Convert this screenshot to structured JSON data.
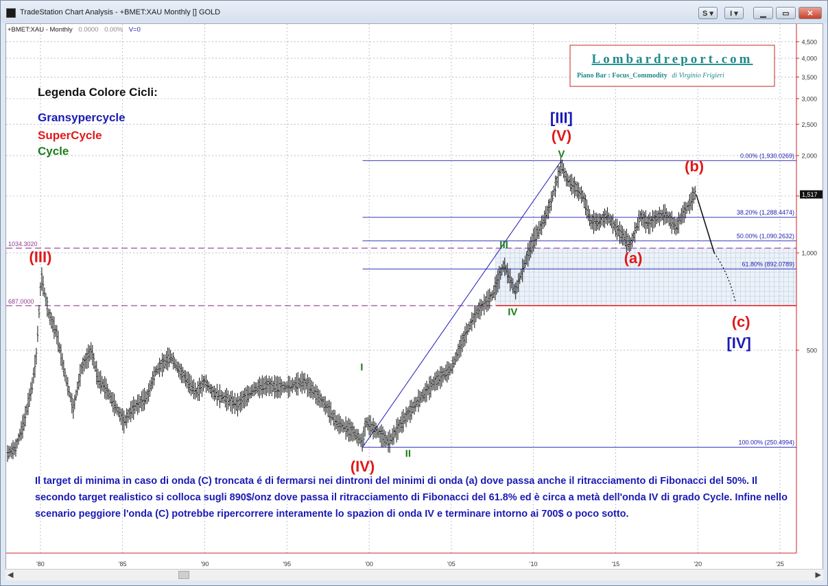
{
  "window": {
    "title": "TradeStation Chart Analysis - +BMET:XAU Monthly [] GOLD",
    "buttons": {
      "s": "S",
      "i": "I"
    }
  },
  "chart_header": {
    "symbol": "+BMET:XAU - Monthly",
    "value1": "0.0000",
    "value2": "0.00%",
    "volume": "V=0"
  },
  "brand": {
    "name": "Lombardreport.com",
    "subtitle_bold": "Piano Bar : Focus_Commodity",
    "subtitle_author": "di Virginio Frigieri"
  },
  "legend": {
    "title": "Legenda Colore Cicli:",
    "items": [
      {
        "label": "Gransypercycle",
        "color": "#1a1ab4"
      },
      {
        "label": "SuperCycle",
        "color": "#e01818"
      },
      {
        "label": "Cycle",
        "color": "#1c7d1c"
      }
    ]
  },
  "chart_data": {
    "type": "line",
    "scale": "log",
    "ylim": [
      200,
      5000
    ],
    "xlim": [
      1978.0,
      2026.0
    ],
    "x_ticks": [
      "'80",
      "'85",
      "'90",
      "'95",
      "'00",
      "'05",
      "'10",
      "'15",
      "'20",
      "'25"
    ],
    "x_tick_years": [
      1980,
      1985,
      1990,
      1995,
      2000,
      2005,
      2010,
      2015,
      2020,
      2025
    ],
    "y_ticks": [
      500,
      1000,
      1500,
      2000,
      2500,
      3000,
      3500,
      4000,
      4500
    ],
    "y_tick_labels": [
      "500",
      "1,000",
      "1,500",
      "2,000",
      "2,500",
      "3,000",
      "3,500",
      "4,000",
      "4,500"
    ],
    "last_price_label": "1,517",
    "series": [
      {
        "x": [
          1978.0,
          1978.5,
          1979.0,
          1979.5,
          1979.75,
          1980.05,
          1980.5,
          1981.0,
          1981.5,
          1982.0,
          1982.5,
          1983.1,
          1983.5,
          1984.0,
          1984.5,
          1985.1,
          1985.6,
          1986.5,
          1987.0,
          1987.9,
          1988.5,
          1989.0,
          1989.5,
          1990.0,
          1990.5,
          1991.0,
          1992.0,
          1993.0,
          1993.7,
          1994.5,
          1995.0,
          1996.0,
          1996.5,
          1997.5,
          1998.0,
          1999.0,
          1999.6,
          1999.8,
          2000.5,
          2001.2,
          2002.0,
          2003.0,
          2004.0,
          2005.0,
          2006.0,
          2006.5,
          2007.5,
          2008.2,
          2008.9,
          2009.5,
          2010.0,
          2010.5,
          2011.0,
          2011.7,
          2012.0,
          2012.5,
          2013.0,
          2013.5,
          2014.0,
          2014.5,
          2015.0,
          2015.9,
          2016.5,
          2017.0,
          2017.5,
          2018.0,
          2018.7,
          2019.0,
          2019.5,
          2019.9
        ],
        "values": [
          240,
          250,
          300,
          390,
          480,
          850,
          650,
          560,
          420,
          330,
          440,
          500,
          410,
          380,
          340,
          300,
          330,
          360,
          430,
          480,
          430,
          400,
          370,
          400,
          370,
          360,
          340,
          380,
          390,
          385,
          385,
          400,
          380,
          330,
          300,
          280,
          260,
          300,
          280,
          260,
          300,
          350,
          400,
          440,
          580,
          650,
          740,
          920,
          760,
          940,
          1100,
          1220,
          1400,
          1880,
          1700,
          1600,
          1500,
          1250,
          1250,
          1300,
          1200,
          1060,
          1300,
          1230,
          1290,
          1320,
          1200,
          1300,
          1420,
          1560
        ]
      }
    ],
    "projection": {
      "x": [
        2019.9,
        2021.0,
        2022.3
      ],
      "values": [
        1517,
        1000,
        700
      ]
    },
    "fibonacci": [
      {
        "label": "0.00% (1,930.0269)",
        "value": 1930.0269
      },
      {
        "label": "38.20% (1,288.4474)",
        "value": 1288.4474
      },
      {
        "label": "50.00% (1,090.2632)",
        "value": 1090.2632
      },
      {
        "label": "61.80% (892.0789)",
        "value": 892.0789
      },
      {
        "label": "100.00% (250.4994)",
        "value": 250.4994
      }
    ],
    "levels": [
      {
        "label": "1034.3020",
        "value": 1034.302
      },
      {
        "label": "687.0000",
        "value": 687.0
      }
    ],
    "trendline": {
      "x": [
        1999.6,
        2011.7
      ],
      "values": [
        250.4994,
        1930.0269
      ]
    },
    "wave_labels": [
      {
        "text": "(III)",
        "x": 1980.0,
        "y": 850,
        "color": "#e01818"
      },
      {
        "text": "(IV)",
        "x": 1999.6,
        "y": 250,
        "color": "#e01818"
      },
      {
        "text": "I",
        "x": 1999.8,
        "y": 300,
        "color": "#1c7d1c"
      },
      {
        "text": "II",
        "x": 2001.2,
        "y": 258,
        "color": "#1c7d1c"
      },
      {
        "text": "III",
        "x": 2008.2,
        "y": 1010,
        "color": "#1c7d1c"
      },
      {
        "text": "IV",
        "x": 2008.9,
        "y": 700,
        "color": "#1c7d1c"
      },
      {
        "text": "V",
        "x": 2011.7,
        "y": 1920,
        "color": "#1c7d1c"
      },
      {
        "text": "(V)",
        "x": 2011.7,
        "y": 1920,
        "color": "#e01818"
      },
      {
        "text": "[III]",
        "x": 2011.7,
        "y": 1920,
        "color": "#1a1ab4"
      },
      {
        "text": "(a)",
        "x": 2015.9,
        "y": 1050,
        "color": "#e01818"
      },
      {
        "text": "(b)",
        "x": 2019.7,
        "y": 1560,
        "color": "#e01818"
      },
      {
        "text": "(c)",
        "x": 2022.5,
        "y": 690,
        "color": "#e01818"
      },
      {
        "text": "[IV]",
        "x": 2022.5,
        "y": 690,
        "color": "#1a1ab4"
      }
    ]
  },
  "commentary": "Il target di minima in  caso di onda (C) troncata é di fermarsi nei dintroni del minimi di onda (a) dove passa anche il ritracciamento di Fibonacci del 50%. Il secondo target realistico si colloca sugli 890$/onz dove passa il ritracciamento di Fibonacci del 61.8% ed è circa a metà dell'onda IV di grado Cycle. Infine nello scenario peggiore l'onda (C) potrebbe ripercorrere interamente lo spazion di onda IV e terminare intorno ai 700$ o poco sotto."
}
